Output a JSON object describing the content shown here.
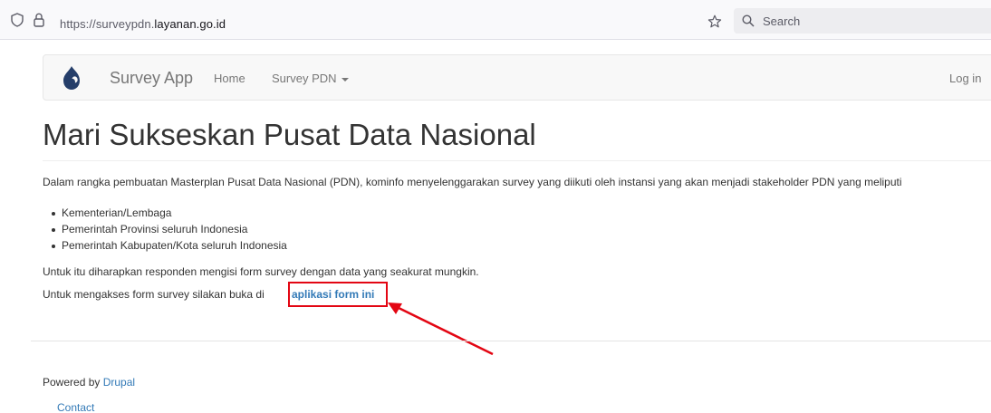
{
  "browser": {
    "url_prefix": "https://surveypdn.",
    "url_domain": "layanan.go.id",
    "search_placeholder": "Search"
  },
  "navbar": {
    "brand": "Survey App",
    "home": "Home",
    "survey_pdn": "Survey PDN",
    "login": "Log in"
  },
  "main": {
    "title": "Mari Sukseskan Pusat Data Nasional",
    "intro": "Dalam rangka pembuatan Masterplan Pusat Data Nasional (PDN), kominfo menyelenggarakan survey yang diikuti oleh instansi yang akan menjadi stakeholder PDN  yang meliputi",
    "list": [
      "Kementerian/Lembaga",
      "Pemerintah Provinsi seluruh Indonesia",
      "Pemerintah Kabupaten/Kota seluruh Indonesia"
    ],
    "note": "Untuk itu diharapkan responden mengisi form survey dengan data yang seakurat mungkin.",
    "access_text": "Untuk mengakses form survey silakan buka di",
    "access_link": "aplikasi form ini"
  },
  "footer": {
    "powered_prefix": "Powered by",
    "powered_link": "Drupal",
    "contact": "Contact"
  },
  "colors": {
    "link": "#337ab7",
    "highlight": "#e30613"
  },
  "icons": [
    "shield-icon",
    "lock-icon",
    "star-icon",
    "search-icon",
    "drupal-logo-icon",
    "caret-down-icon",
    "annotation-arrow-icon"
  ]
}
